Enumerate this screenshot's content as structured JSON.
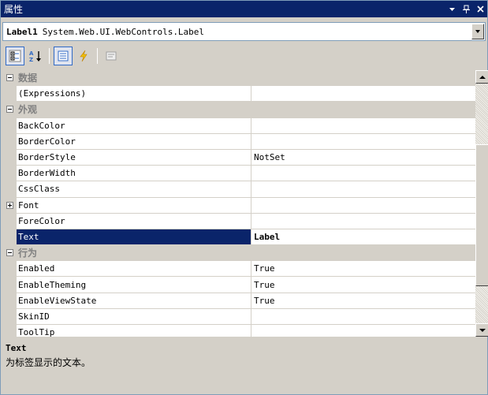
{
  "window": {
    "title": "属性",
    "controls": [
      "▼",
      "ᵽ",
      "×"
    ]
  },
  "object_selector": {
    "name": "Label1",
    "type": "System.Web.UI.WebControls.Label"
  },
  "toolbar": {
    "buttons": [
      "categorized-icon",
      "alphabetical-icon",
      "properties-icon",
      "events-icon",
      "property-pages-icon"
    ]
  },
  "grid": {
    "rows": [
      {
        "kind": "category",
        "label": "数据"
      },
      {
        "kind": "prop",
        "name": "(Expressions)",
        "value": ""
      },
      {
        "kind": "category",
        "label": "外观"
      },
      {
        "kind": "prop",
        "name": "BackColor",
        "value": ""
      },
      {
        "kind": "prop",
        "name": "BorderColor",
        "value": ""
      },
      {
        "kind": "prop",
        "name": "BorderStyle",
        "value": "NotSet"
      },
      {
        "kind": "prop",
        "name": "BorderWidth",
        "value": ""
      },
      {
        "kind": "prop",
        "name": "CssClass",
        "value": ""
      },
      {
        "kind": "prop",
        "name": "Font",
        "value": ""
      },
      {
        "kind": "prop",
        "name": "ForeColor",
        "value": ""
      },
      {
        "kind": "prop",
        "name": "Text",
        "value": "Label"
      },
      {
        "kind": "category",
        "label": "行为"
      },
      {
        "kind": "prop",
        "name": "Enabled",
        "value": "True"
      },
      {
        "kind": "prop",
        "name": "EnableTheming",
        "value": "True"
      },
      {
        "kind": "prop",
        "name": "EnableViewState",
        "value": "True"
      },
      {
        "kind": "prop",
        "name": "SkinID",
        "value": ""
      },
      {
        "kind": "prop",
        "name": "ToolTip",
        "value": ""
      }
    ]
  },
  "description": {
    "title": "Text",
    "text": "为标签显示的文本。"
  },
  "colors": {
    "titlebar": "#0a246a",
    "selection": "#0a246a",
    "chrome": "#d4d0c8"
  }
}
